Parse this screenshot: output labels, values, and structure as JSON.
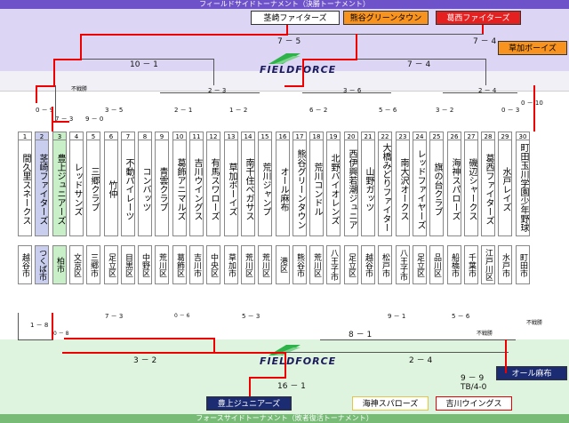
{
  "titles": {
    "top": "フィールドサイドトーナメント（決勝トーナメント）",
    "bottom": "フォースサイドトーナメント（敗者復活トーナメント）"
  },
  "logo": {
    "text": "FIELDFORCE",
    "top_aria": "",
    "bottom_aria": ""
  },
  "top_boxes": {
    "champion": "茎崎ファイターズ",
    "second": "熊谷グリーンタウン",
    "third": "葛西ファイターズ",
    "fourth": "草加ボーイズ"
  },
  "bottom_boxes": {
    "first": "豊上ジュニアーズ",
    "second": "海神スパローズ",
    "third": "吉川ウイングス",
    "fourth": "オール麻布"
  },
  "top_scores": {
    "final": "7 － 5",
    "semi_right": "7 － 4",
    "qf_left": "10 － 1",
    "qf_right": "7 － 4",
    "l3_a": "2 － 3",
    "l3_b": "3 － 6",
    "l3_c": "2 － 4",
    "fusen1": "不戦勝",
    "r1": [
      "0 － 9",
      "7 － 3",
      "9 － 0",
      "3 － 5",
      "2 － 1",
      "1 － 2",
      "6 － 2",
      "5 － 6",
      "3 － 2",
      "0 － 3",
      "0 － 10"
    ]
  },
  "bottom_scores": {
    "final": "16 － 1",
    "sf_left": "3 － 2",
    "sf_right": "2 － 4",
    "r3_a": "8 － 1",
    "r3_b": "5 － 6",
    "r2_a": "7 － 3",
    "r2_b": "5 － 3",
    "r2_c": "9 － 1",
    "r1_a": "1 － 8",
    "r1_b": "0 － 8",
    "r1_c": "0 － 6",
    "fusen2": "不戦勝",
    "fusen3": "不戦勝",
    "extra": "9 － 9",
    "tb": "TB/4-0"
  },
  "teams": [
    {
      "num": "1",
      "name": "間久里スネークス",
      "area": "越谷市"
    },
    {
      "num": "2",
      "name": "茎崎ファイターズ",
      "area": "つくば市"
    },
    {
      "num": "3",
      "name": "豊上ジュニアーズ",
      "area": "柏市"
    },
    {
      "num": "4",
      "name": "レッドサンズ",
      "area": "文京区"
    },
    {
      "num": "5",
      "name": "三郷クラブ",
      "area": "三郷市"
    },
    {
      "num": "6",
      "name": "竹仲",
      "area": "足立区"
    },
    {
      "num": "7",
      "name": "不動パイレーツ",
      "area": "目黒区"
    },
    {
      "num": "8",
      "name": "コンバッツ",
      "area": "中野区"
    },
    {
      "num": "9",
      "name": "青雲クラブ",
      "area": "荒川区"
    },
    {
      "num": "10",
      "name": "葛飾アニマルズ",
      "area": "葛飾区"
    },
    {
      "num": "11",
      "name": "吉川ウイングス",
      "area": "吉川市"
    },
    {
      "num": "12",
      "name": "有馬スワローズ",
      "area": "中央区"
    },
    {
      "num": "13",
      "name": "草加ボーイズ",
      "area": "草加市"
    },
    {
      "num": "14",
      "name": "南千住ペガサス",
      "area": "荒川区"
    },
    {
      "num": "15",
      "name": "荒川ジャンプ",
      "area": "荒川区"
    },
    {
      "num": "16",
      "name": "オール麻布",
      "area": "港区"
    },
    {
      "num": "17",
      "name": "熊谷グリーンタウン",
      "area": "熊谷市"
    },
    {
      "num": "18",
      "name": "荒川コンドル",
      "area": "荒川区"
    },
    {
      "num": "19",
      "name": "北野バイオレンズ",
      "area": "八王子市"
    },
    {
      "num": "20",
      "name": "西伊興若潮ジュニア",
      "area": "足立区"
    },
    {
      "num": "21",
      "name": "山野ガッツ",
      "area": "越谷市"
    },
    {
      "num": "22",
      "name": "大橋みどりファイターズ",
      "area": "松戸市"
    },
    {
      "num": "23",
      "name": "南大沢オークス",
      "area": "八王子市"
    },
    {
      "num": "24",
      "name": "レッドファイヤーズ",
      "area": "足立区"
    },
    {
      "num": "25",
      "name": "旗の台クラブ",
      "area": "品川区"
    },
    {
      "num": "26",
      "name": "海神スパローズ",
      "area": "船橋市"
    },
    {
      "num": "27",
      "name": "磯辺シャークス",
      "area": "千葉市"
    },
    {
      "num": "28",
      "name": "葛西ファイターズ",
      "area": "江戸川区"
    },
    {
      "num": "29",
      "name": "水戸レイズ",
      "area": "水戸市"
    },
    {
      "num": "30",
      "name": "町田玉川学園少年野球クラブ",
      "area": "町田市"
    }
  ],
  "colors": {
    "winner_line": "#e00000",
    "top_band": "#dcd6f4",
    "bottom_band": "#dff4df"
  }
}
